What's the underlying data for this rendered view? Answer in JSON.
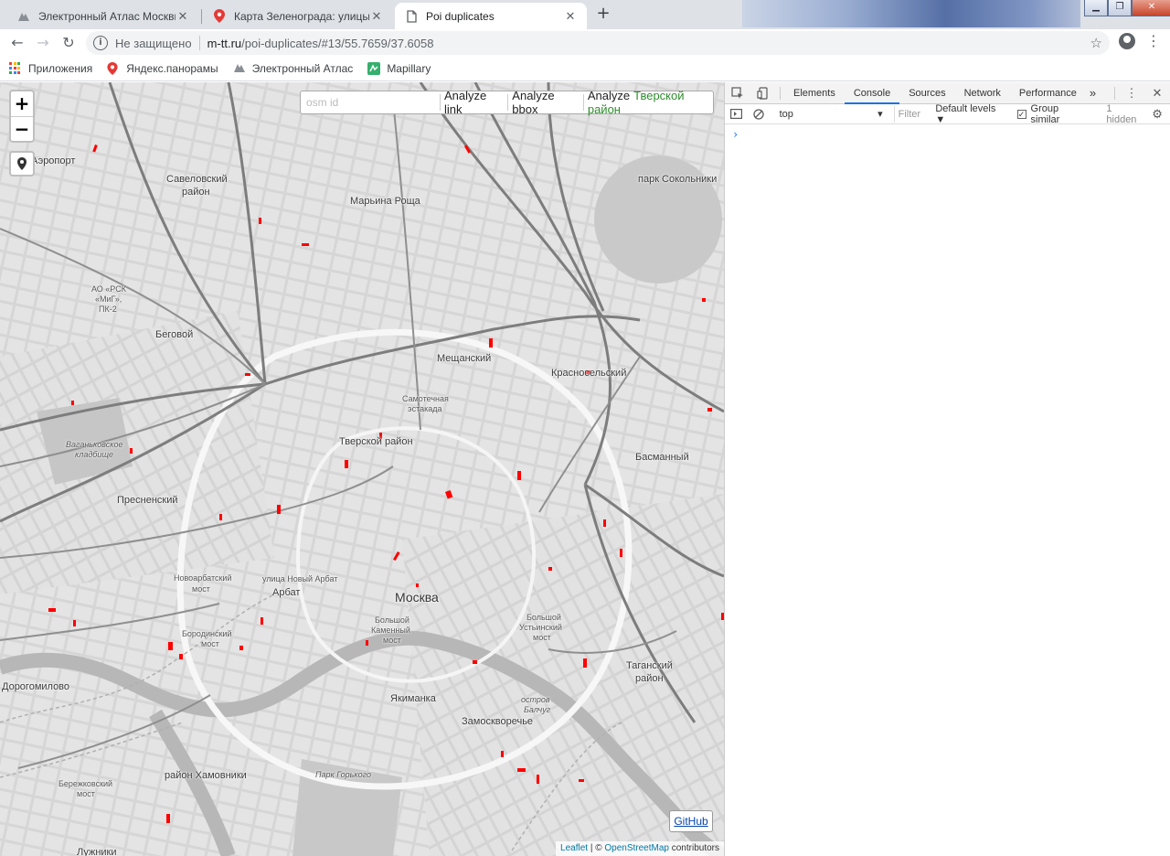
{
  "tabs": [
    {
      "title": "Электронный Атлас Москвы",
      "close": "✕"
    },
    {
      "title": "Карта Зеленограда: улицы, дом",
      "close": "✕"
    },
    {
      "title": "Poi duplicates",
      "close": "✕"
    }
  ],
  "new_tab": "+",
  "window_buttons": {
    "minimize": "▁",
    "restore": "❐",
    "close": "✕"
  },
  "toolbar": {
    "back": "←",
    "forward": "→",
    "reload": "↻",
    "security": "Не защищено",
    "host": "m-tt.ru",
    "path": "/poi-duplicates/#13/55.7659/37.6058"
  },
  "bookmarks": [
    {
      "label": "Приложения"
    },
    {
      "label": "Яндекс.панорамы"
    },
    {
      "label": "Электронный Атлас"
    },
    {
      "label": "Mapillary"
    }
  ],
  "map": {
    "zoom_in": "+",
    "zoom_out": "−",
    "search": {
      "placeholder": "osm id",
      "analyze_link": "Analyze link",
      "analyze_bbox": "Analyze bbox",
      "analyze": "Analyze",
      "district": "Тверской район"
    },
    "github": "GitHub",
    "attribution": {
      "leaflet": "Leaflet",
      "sep": " | © ",
      "osm": "OpenStreetMap",
      "tail": " contributors"
    },
    "labels": {
      "aeroport": "Аэропорт",
      "savelovsky": "Савеловский",
      "savelovsky2": "район",
      "marina": "Марьина Роща",
      "sokolniki": "парк Сокольники",
      "beg": "Беговой",
      "meshch": "Мещанский",
      "krasnosel": "Красносельский",
      "samot": "Самотечная",
      "samot2": "эстакада",
      "tver": "Тверской район",
      "basman": "Басманный",
      "vagan": "Ваганьковское",
      "vagan2": "кладбище",
      "presnya": "Пресненский",
      "arbat": "Арбат",
      "novoarb": "Новоарбатский",
      "novoarb2": "мост",
      "moskva": "Москва",
      "bkm": "Большой",
      "bkm2": "Каменный",
      "bkm3": "мост",
      "bum": "Большой",
      "bum2": "Устьинский",
      "bum3": "мост",
      "borod": "Бородинский",
      "borod2": "мост",
      "dorog": "Дорогомилово",
      "yakim": "Якиманка",
      "zamosk": "Замоскворечье",
      "balchug": "остров",
      "balchug2": "Балчуг",
      "tagan": "Таганский",
      "tagan2": "район",
      "khamov": "район Хамовники",
      "berezh": "Бережковский",
      "berezh2": "мост",
      "park_gork": "Парк Горького",
      "novy_arbat": "улица Новый Арбат",
      "ao_rsk": "АО «РСК",
      "ao_rsk2": "«МиГ»,",
      "ao_rsk3": "ПК-2",
      "luzh": "Лужники"
    }
  },
  "devtools": {
    "tabs": [
      "Elements",
      "Console",
      "Sources",
      "Network",
      "Performance"
    ],
    "more": "»",
    "context": "top",
    "filter": "Filter",
    "levels": "Default levels ▼",
    "group_similar": "Group similar",
    "hidden": "1 hidden",
    "prompt": "›"
  },
  "colors": {
    "accent": "#1a73e8",
    "duplicate": "#ff0000",
    "district": "#2e8b2e"
  }
}
